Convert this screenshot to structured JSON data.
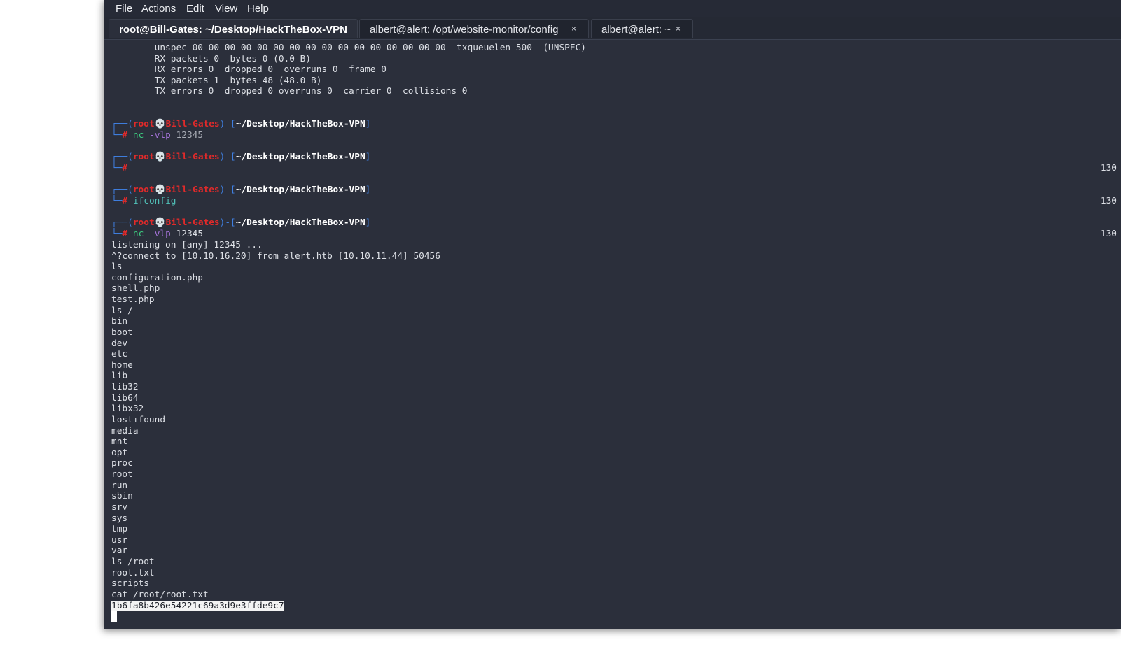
{
  "menubar": {
    "items": [
      "File",
      "Actions",
      "Edit",
      "View",
      "Help"
    ]
  },
  "tabs": [
    {
      "label": "root@Bill-Gates: ~/Desktop/HackTheBox-VPN",
      "close": "×"
    },
    {
      "label": "albert@alert: /opt/website-monitor/config",
      "close": "×"
    },
    {
      "label": "albert@alert: ~",
      "close": "×"
    }
  ],
  "terminal": {
    "ifconfig_tail": [
      "        unspec 00-00-00-00-00-00-00-00-00-00-00-00-00-00-00-00  txqueuelen 500  (UNSPEC)",
      "        RX packets 0  bytes 0 (0.0 B)",
      "        RX errors 0  dropped 0  overruns 0  frame 0",
      "        TX packets 1  bytes 48 (48.0 B)",
      "        TX errors 0  dropped 0 overruns 0  carrier 0  collisions 0"
    ],
    "prompt": {
      "corner_top": "┌──(",
      "user": "root",
      "skull": "💀",
      "host": "Bill-Gates",
      "sep": ")-[",
      "path": "~/Desktop/HackTheBox-VPN",
      "close": "]",
      "corner_bottom": "└─",
      "hash": "#"
    },
    "commands": [
      {
        "prog": "nc",
        "flag": "-vlp",
        "arg": "12345",
        "exit": ""
      },
      {
        "prog": "",
        "flag": "",
        "arg": "",
        "exit": "130"
      },
      {
        "prog": "ifconfig",
        "flag": "",
        "arg": "",
        "exit": "130"
      },
      {
        "prog": "nc",
        "flag": "-vlp",
        "arg": "12345",
        "exit": "130"
      }
    ],
    "output": [
      "listening on [any] 12345 ...",
      "^?connect to [10.10.16.20] from alert.htb [10.10.11.44] 50456",
      "ls",
      "configuration.php",
      "shell.php",
      "test.php",
      "ls /",
      "bin",
      "boot",
      "dev",
      "etc",
      "home",
      "lib",
      "lib32",
      "lib64",
      "libx32",
      "lost+found",
      "media",
      "mnt",
      "opt",
      "proc",
      "root",
      "run",
      "sbin",
      "srv",
      "sys",
      "tmp",
      "usr",
      "var",
      "ls /root",
      "root.txt",
      "scripts",
      "cat /root/root.txt"
    ],
    "flag": "1b6fa8b426e54221c69a3d9e3ffde9c7"
  }
}
